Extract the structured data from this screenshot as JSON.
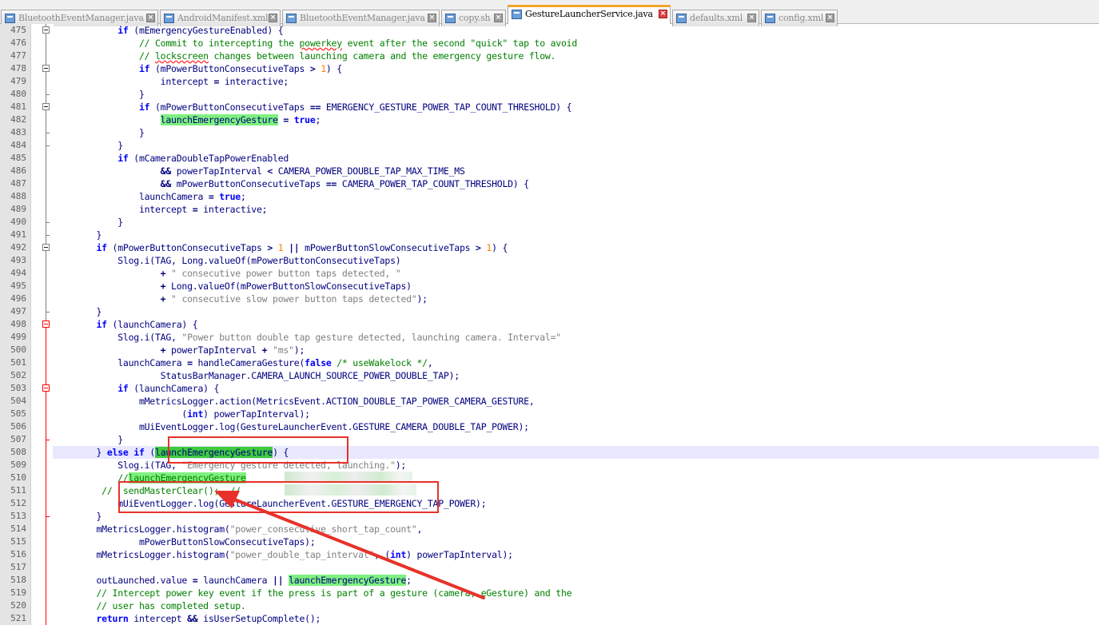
{
  "tabs": [
    {
      "label": "BluetoothEventManager.java",
      "active": false
    },
    {
      "label": "AndroidManifest.xml",
      "active": false
    },
    {
      "label": "BluetoothEventManager.java",
      "active": false
    },
    {
      "label": "copy.sh",
      "active": false
    },
    {
      "label": "GestureLauncherService.java",
      "active": true
    },
    {
      "label": "defaults.xml",
      "active": false
    },
    {
      "label": "config.xml",
      "active": false
    }
  ],
  "colors": {
    "highlight": "#7ef07e",
    "annotation_red": "#e8312a",
    "keyword": "#0000ff",
    "comment": "#008000",
    "string": "#808080",
    "number": "#ff8000",
    "active_tab_accent": "#f3a629"
  },
  "current_line": 508,
  "lines": [
    {
      "n": "475",
      "t": [
        [
          "            ",
          ""
        ],
        [
          "if",
          "kw"
        ],
        [
          " (mEmergencyGestureEnabled) {",
          ""
        ]
      ]
    },
    {
      "n": "476",
      "t": [
        [
          "                ",
          ""
        ],
        [
          "// Commit to intercepting the ",
          "cm"
        ],
        [
          "powerkey",
          "cm spell"
        ],
        [
          " event after the second \"quick\" tap to avoid",
          "cm"
        ]
      ]
    },
    {
      "n": "477",
      "t": [
        [
          "                ",
          ""
        ],
        [
          "// ",
          "cm"
        ],
        [
          "lockscreen",
          "cm spell"
        ],
        [
          " changes between launching camera and the emergency gesture flow.",
          "cm"
        ]
      ]
    },
    {
      "n": "478",
      "t": [
        [
          "                ",
          ""
        ],
        [
          "if",
          "kw"
        ],
        [
          " (mPowerButtonConsecutiveTaps ",
          ""
        ],
        [
          ">",
          "op"
        ],
        [
          " ",
          ""
        ],
        [
          "1",
          "num"
        ],
        [
          ") {",
          ""
        ]
      ]
    },
    {
      "n": "479",
      "t": [
        [
          "                    intercept ",
          ""
        ],
        [
          "=",
          "op"
        ],
        [
          " interactive;",
          ""
        ]
      ]
    },
    {
      "n": "480",
      "t": [
        [
          "                }",
          ""
        ]
      ]
    },
    {
      "n": "481",
      "t": [
        [
          "                ",
          ""
        ],
        [
          "if",
          "kw"
        ],
        [
          " (mPowerButtonConsecutiveTaps ",
          ""
        ],
        [
          "==",
          "op"
        ],
        [
          " EMERGENCY_GESTURE_POWER_TAP_COUNT_THRESHOLD) {",
          ""
        ]
      ]
    },
    {
      "n": "482",
      "t": [
        [
          "                    ",
          ""
        ],
        [
          "launchEmergencyGesture",
          "hl"
        ],
        [
          " ",
          ""
        ],
        [
          "=",
          "op"
        ],
        [
          " ",
          ""
        ],
        [
          "true",
          "kw"
        ],
        [
          ";",
          ""
        ]
      ]
    },
    {
      "n": "483",
      "t": [
        [
          "                }",
          ""
        ]
      ]
    },
    {
      "n": "484",
      "t": [
        [
          "            }",
          ""
        ]
      ]
    },
    {
      "n": "485",
      "t": [
        [
          "            ",
          ""
        ],
        [
          "if",
          "kw"
        ],
        [
          " (mCameraDoubleTapPowerEnabled",
          ""
        ]
      ]
    },
    {
      "n": "486",
      "t": [
        [
          "                    ",
          ""
        ],
        [
          "&&",
          "op"
        ],
        [
          " powerTapInterval ",
          ""
        ],
        [
          "<",
          "op"
        ],
        [
          " CAMERA_POWER_DOUBLE_TAP_MAX_TIME_MS",
          ""
        ]
      ]
    },
    {
      "n": "487",
      "t": [
        [
          "                    ",
          ""
        ],
        [
          "&&",
          "op"
        ],
        [
          " mPowerButtonConsecutiveTaps ",
          ""
        ],
        [
          "==",
          "op"
        ],
        [
          " CAMERA_POWER_TAP_COUNT_THRESHOLD) {",
          ""
        ]
      ]
    },
    {
      "n": "488",
      "t": [
        [
          "                launchCamera ",
          ""
        ],
        [
          "=",
          "op"
        ],
        [
          " ",
          ""
        ],
        [
          "true",
          "kw"
        ],
        [
          ";",
          ""
        ]
      ]
    },
    {
      "n": "489",
      "t": [
        [
          "                intercept ",
          ""
        ],
        [
          "=",
          "op"
        ],
        [
          " interactive;",
          ""
        ]
      ]
    },
    {
      "n": "490",
      "t": [
        [
          "            }",
          ""
        ]
      ]
    },
    {
      "n": "491",
      "t": [
        [
          "        }",
          ""
        ]
      ]
    },
    {
      "n": "492",
      "t": [
        [
          "        ",
          ""
        ],
        [
          "if",
          "kw"
        ],
        [
          " (mPowerButtonConsecutiveTaps ",
          ""
        ],
        [
          ">",
          "op"
        ],
        [
          " ",
          ""
        ],
        [
          "1",
          "num"
        ],
        [
          " ",
          ""
        ],
        [
          "||",
          "op"
        ],
        [
          " mPowerButtonSlowConsecutiveTaps ",
          ""
        ],
        [
          ">",
          "op"
        ],
        [
          " ",
          ""
        ],
        [
          "1",
          "num"
        ],
        [
          ") {",
          ""
        ]
      ]
    },
    {
      "n": "493",
      "t": [
        [
          "            Slog.i(TAG, Long.valueOf(mPowerButtonConsecutiveTaps)",
          ""
        ]
      ]
    },
    {
      "n": "494",
      "t": [
        [
          "                    ",
          ""
        ],
        [
          "+",
          "op"
        ],
        [
          " ",
          ""
        ],
        [
          "\" consecutive power button taps detected, \"",
          "str"
        ]
      ]
    },
    {
      "n": "495",
      "t": [
        [
          "                    ",
          ""
        ],
        [
          "+",
          "op"
        ],
        [
          " Long.valueOf(mPowerButtonSlowConsecutiveTaps)",
          ""
        ]
      ]
    },
    {
      "n": "496",
      "t": [
        [
          "                    ",
          ""
        ],
        [
          "+",
          "op"
        ],
        [
          " ",
          ""
        ],
        [
          "\" consecutive slow power button taps detected\"",
          "str"
        ],
        [
          ");",
          ""
        ]
      ]
    },
    {
      "n": "497",
      "t": [
        [
          "        }",
          ""
        ]
      ]
    },
    {
      "n": "498",
      "t": [
        [
          "        ",
          ""
        ],
        [
          "if",
          "kw"
        ],
        [
          " (launchCamera) {",
          ""
        ]
      ]
    },
    {
      "n": "499",
      "t": [
        [
          "            Slog.i(TAG, ",
          ""
        ],
        [
          "\"Power button double tap gesture detected, launching camera. Interval=\"",
          "str"
        ]
      ]
    },
    {
      "n": "500",
      "t": [
        [
          "                    ",
          ""
        ],
        [
          "+",
          "op"
        ],
        [
          " powerTapInterval ",
          ""
        ],
        [
          "+",
          "op"
        ],
        [
          " ",
          ""
        ],
        [
          "\"ms\"",
          "str"
        ],
        [
          ");",
          ""
        ]
      ]
    },
    {
      "n": "501",
      "t": [
        [
          "            launchCamera ",
          ""
        ],
        [
          "=",
          "op"
        ],
        [
          " handleCameraGesture(",
          ""
        ],
        [
          "false",
          "kw"
        ],
        [
          " ",
          ""
        ],
        [
          "/* useWakelock */",
          "cm"
        ],
        [
          ",",
          ""
        ]
      ]
    },
    {
      "n": "502",
      "t": [
        [
          "                    StatusBarManager.CAMERA_LAUNCH_SOURCE_POWER_DOUBLE_TAP);",
          ""
        ]
      ]
    },
    {
      "n": "503",
      "t": [
        [
          "            ",
          ""
        ],
        [
          "if",
          "kw"
        ],
        [
          " (launchCamera) {",
          ""
        ]
      ]
    },
    {
      "n": "504",
      "t": [
        [
          "                mMetricsLogger.action(MetricsEvent.ACTION_DOUBLE_TAP_POWER_CAMERA_GESTURE,",
          ""
        ]
      ]
    },
    {
      "n": "505",
      "t": [
        [
          "                        (",
          ""
        ],
        [
          "int",
          "kw"
        ],
        [
          ") powerTapInterval);",
          ""
        ]
      ]
    },
    {
      "n": "506",
      "t": [
        [
          "                mUiEventLogger.log(GestureLauncherEvent.GESTURE_CAMERA_DOUBLE_TAP_POWER);",
          ""
        ]
      ]
    },
    {
      "n": "507",
      "t": [
        [
          "            }",
          ""
        ]
      ]
    },
    {
      "n": "508",
      "t": [
        [
          "        } ",
          ""
        ],
        [
          "else",
          "kw"
        ],
        [
          " ",
          ""
        ],
        [
          "if",
          "kw"
        ],
        [
          " (",
          ""
        ],
        [
          "launchEmergencyGesture",
          "hl2"
        ],
        [
          ") {",
          ""
        ]
      ]
    },
    {
      "n": "509",
      "t": [
        [
          "            Slog.i(TAG, ",
          ""
        ],
        [
          "\"Emergency gesture detected, launching.\"",
          "str"
        ],
        [
          ");",
          ""
        ]
      ]
    },
    {
      "n": "510",
      "t": [
        [
          "            ",
          ""
        ],
        [
          "//",
          "cm"
        ],
        [
          "launchEmergencyGesture",
          "cm hl"
        ],
        [
          "                    ture();",
          "cm"
        ]
      ]
    },
    {
      "n": "511",
      "t": [
        [
          "         ",
          ""
        ],
        [
          "//  sendMasterClear();  //",
          "cm"
        ]
      ]
    },
    {
      "n": "512",
      "t": [
        [
          "            mUiEventLogger.log(GestureLauncherEvent.GESTURE_EMERGENCY_TAP_POWER);",
          ""
        ]
      ]
    },
    {
      "n": "513",
      "t": [
        [
          "        }",
          ""
        ]
      ]
    },
    {
      "n": "514",
      "t": [
        [
          "        mMetricsLogger.histogram(",
          ""
        ],
        [
          "\"power_consecutive_short_tap_count\"",
          "str"
        ],
        [
          ",",
          ""
        ]
      ]
    },
    {
      "n": "515",
      "t": [
        [
          "                mPowerButtonSlowConsecutiveTaps);",
          ""
        ]
      ]
    },
    {
      "n": "516",
      "t": [
        [
          "        mMetricsLogger.histogram(",
          ""
        ],
        [
          "\"power_double_tap_interval\"",
          "str"
        ],
        [
          ", (",
          ""
        ],
        [
          "int",
          "kw"
        ],
        [
          ") powerTapInterval);",
          ""
        ]
      ]
    },
    {
      "n": "517",
      "t": [
        [
          "",
          ""
        ]
      ]
    },
    {
      "n": "518",
      "t": [
        [
          "        outLaunched.value ",
          ""
        ],
        [
          "=",
          "op"
        ],
        [
          " launchCamera ",
          ""
        ],
        [
          "||",
          "op"
        ],
        [
          " ",
          ""
        ],
        [
          "launchEmergencyGesture",
          "hl"
        ],
        [
          ";",
          ""
        ]
      ]
    },
    {
      "n": "519",
      "t": [
        [
          "        ",
          ""
        ],
        [
          "// Intercept power key event if the press is part of a gesture (camera, eGesture) and the",
          "cm"
        ]
      ]
    },
    {
      "n": "520",
      "t": [
        [
          "        ",
          ""
        ],
        [
          "// user has completed setup.",
          "cm"
        ]
      ]
    },
    {
      "n": "521",
      "t": [
        [
          "        ",
          ""
        ],
        [
          "return",
          "kw"
        ],
        [
          " intercept ",
          ""
        ],
        [
          "&&",
          "op"
        ],
        [
          " isUserSetupComplete();",
          ""
        ]
      ]
    }
  ]
}
